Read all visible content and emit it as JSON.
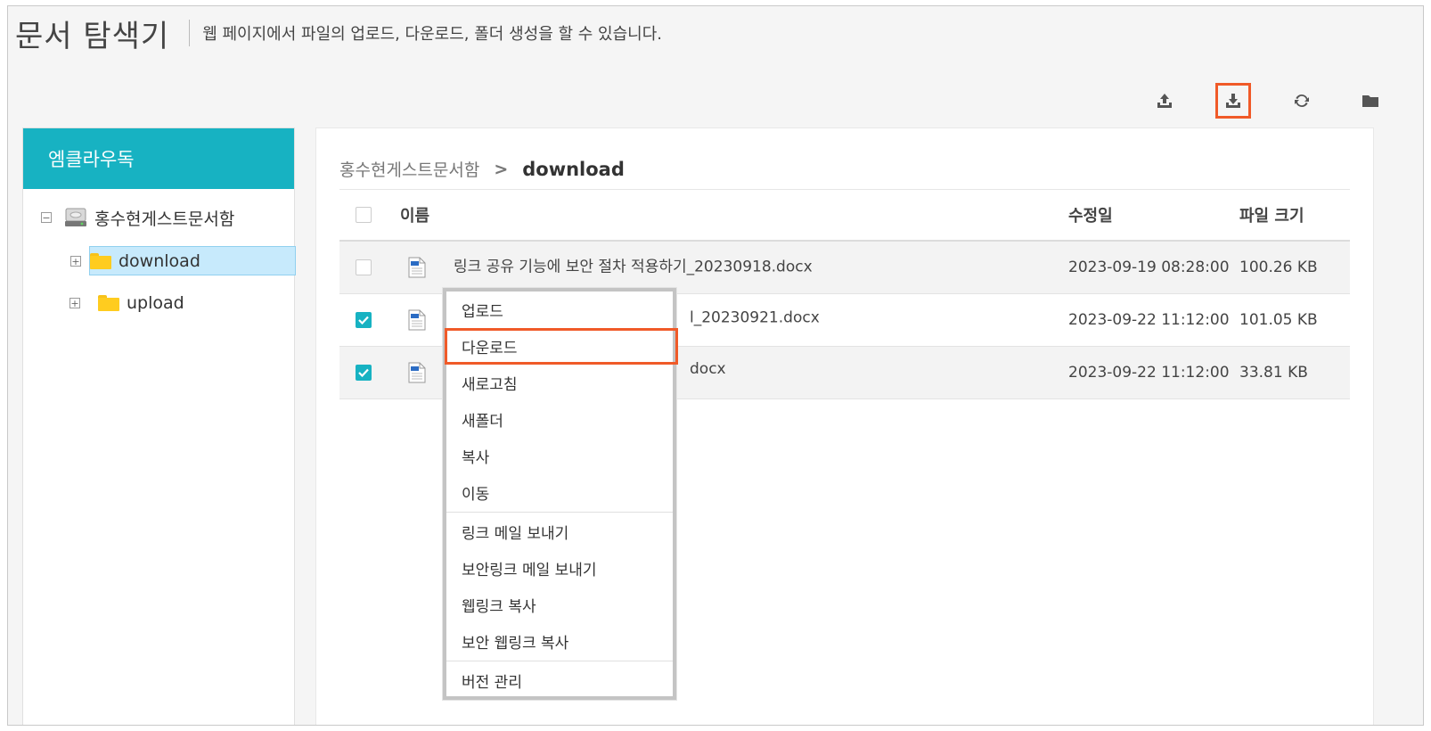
{
  "header": {
    "title": "문서 탐색기",
    "description": "웹 페이지에서 파일의 업로드, 다운로드, 폴더 생성을 할 수 있습니다."
  },
  "toolbar": {
    "buttons": [
      {
        "icon": "upload-icon",
        "highlighted": false
      },
      {
        "icon": "download-icon",
        "highlighted": true
      },
      {
        "icon": "refresh-icon",
        "highlighted": false
      },
      {
        "icon": "folder-icon",
        "highlighted": false
      }
    ]
  },
  "tree": {
    "header": "엠클라우독",
    "root": "홍수현게스트문서함",
    "items": [
      {
        "label": "download",
        "selected": true
      },
      {
        "label": "upload",
        "selected": false
      }
    ]
  },
  "breadcrumb": {
    "root": "홍수현게스트문서함",
    "current": "download"
  },
  "table": {
    "columns": {
      "name": "이름",
      "modified": "수정일",
      "size": "파일 크기"
    },
    "rows": [
      {
        "name": "링크 공유 기능에 보안 절차 적용하기_20230918.docx",
        "modified": "2023-09-19 08:28:00",
        "size": "100.26 KB",
        "checked": false
      },
      {
        "name": "l_20230921.docx",
        "modified": "2023-09-22 11:12:00",
        "size": "101.05 KB",
        "checked": true
      },
      {
        "name": "docx",
        "modified": "2023-09-22 11:12:00",
        "size": "33.81 KB",
        "checked": true
      }
    ]
  },
  "context_menu": {
    "groups": [
      [
        "업로드",
        "다운로드",
        "새로고침",
        "새폴더",
        "복사",
        "이동"
      ],
      [
        "링크 메일 보내기",
        "보안링크 메일 보내기",
        "웹링크 복사",
        "보안 웹링크 복사"
      ],
      [
        "버전 관리"
      ]
    ],
    "highlighted": "다운로드"
  },
  "colors": {
    "accent": "#17b2c2",
    "highlight": "#f05a28",
    "folder": "#ffcc1f"
  }
}
